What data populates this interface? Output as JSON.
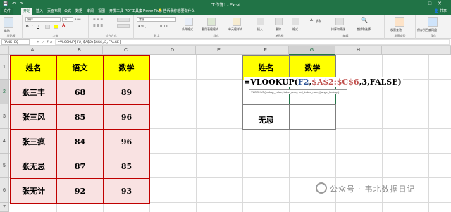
{
  "window": {
    "title": "工作簿1 - Excel",
    "controls": [
      "—",
      "□",
      "✕"
    ]
  },
  "menu": {
    "tabs": [
      "文件",
      "开始",
      "插入",
      "页面布局",
      "公式",
      "数据",
      "审阅",
      "视图",
      "开发工具",
      "PDF工具集",
      "Power Pivot"
    ],
    "active_index": 1,
    "tell_me": "告诉我你想要做什么",
    "share": "共享"
  },
  "ribbon": {
    "groups": [
      {
        "label": "剪贴板",
        "main": "粘贴"
      },
      {
        "label": "字体",
        "font": "宋体",
        "size": "11"
      },
      {
        "label": "对齐方式"
      },
      {
        "label": "数字",
        "format": "常规"
      },
      {
        "label": "样式",
        "items": [
          "条件格式",
          "套用表格格式",
          "单元格样式"
        ]
      },
      {
        "label": "单元格",
        "items": [
          "插入",
          "删除",
          "格式"
        ]
      },
      {
        "label": "编辑",
        "items": [
          "求和",
          "排序和筛选",
          "查找和选择"
        ]
      },
      {
        "label": "发票查验",
        "main": "发票查验"
      },
      {
        "label": "保存",
        "main": "保存到百度网盘"
      }
    ]
  },
  "formula_bar": {
    "name_box": "RANK.EQ",
    "formula": "=VLOOKUP(F2,$A$2:$C$6,3,FALSE)",
    "icons": [
      "✕",
      "✓",
      "fx"
    ]
  },
  "sheet": {
    "columns": [
      "A",
      "B",
      "C",
      "D",
      "E",
      "F",
      "G",
      "H",
      "I"
    ],
    "rows": [
      "1",
      "2",
      "3",
      "4",
      "5",
      "6",
      "7",
      "8"
    ],
    "selected_column": "G",
    "selected_row": "2",
    "table1": {
      "headers": [
        "姓名",
        "语文",
        "数学"
      ],
      "rows": [
        [
          "张三丰",
          "68",
          "89"
        ],
        [
          "张三风",
          "85",
          "96"
        ],
        [
          "张三疯",
          "84",
          "96"
        ],
        [
          "张无忌",
          "87",
          "85"
        ],
        [
          "张无计",
          "92",
          "93"
        ]
      ]
    },
    "table2": {
      "headers": [
        "姓名",
        "数学"
      ],
      "row3_name": "无忌"
    },
    "editing": {
      "parts": [
        {
          "text": "=VLOOKUP(",
          "color": "#000000"
        },
        {
          "text": "F2",
          "color": "#2f5597"
        },
        {
          "text": ",",
          "color": "#000000"
        },
        {
          "text": "$A$2:$C$6",
          "color": "#c0504d"
        },
        {
          "text": ",3,FALSE)",
          "color": "#000000"
        }
      ],
      "tooltip": "VLOOKUP(lookup_value, table_array, col_index_num, [range_lookup])"
    }
  },
  "watermark": "公众号 · 韦北数据日记",
  "colors": {
    "excel_green": "#217346",
    "header_yellow": "#ffff00",
    "pink_fill": "#f9e2e2",
    "border_red": "#c00000"
  }
}
